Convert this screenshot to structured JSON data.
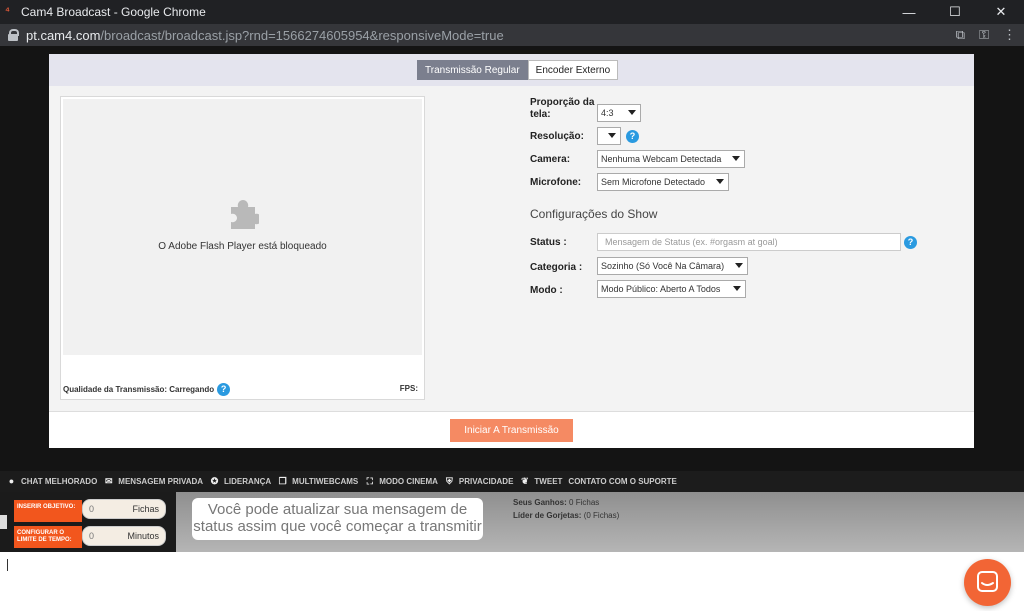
{
  "window": {
    "title": "Cam4 Broadcast - Google Chrome",
    "url_host": "pt.cam4.com",
    "url_path": "/broadcast/broadcast.jsp?rnd=1566274605954&responsiveMode=true"
  },
  "tabs": [
    {
      "label": "Transmissão Regular",
      "active": true
    },
    {
      "label": "Encoder Externo",
      "active": false
    }
  ],
  "video": {
    "blocked_message": "O Adobe Flash Player está bloqueado",
    "quality_label": "Qualidade da Transmissão: Carregando",
    "fps_label": "FPS:"
  },
  "settings": {
    "aspect_label": "Proporção da tela:",
    "aspect_value": "4:3",
    "resolution_label": "Resolução:",
    "resolution_value": "",
    "camera_label": "Camera:",
    "camera_value": "Nenhuma Webcam Detectada",
    "mic_label": "Microfone:",
    "mic_value": "Sem Microfone Detectado"
  },
  "show": {
    "title": "Configurações do Show",
    "status_label": "Status :",
    "status_placeholder": "Mensagem de Status (ex. #orgasm at goal)",
    "category_label": "Categoria :",
    "category_value": "Sozinho (Só Você Na Câmara)",
    "mode_label": "Modo :",
    "mode_value": "Modo Público: Aberto A Todos"
  },
  "start_button": "Iniciar A Transmissão",
  "toolbar": [
    {
      "icon": "chat-bubble-icon",
      "label": "CHAT MELHORADO"
    },
    {
      "icon": "envelope-icon",
      "label": "MENSAGEM PRIVADA"
    },
    {
      "icon": "medal-icon",
      "label": "LIDERANÇA"
    },
    {
      "icon": "multi-window-icon",
      "label": "MULTIWEBCAMS"
    },
    {
      "icon": "fullscreen-icon",
      "label": "MODO CINEMA"
    },
    {
      "icon": "shield-icon",
      "label": "PRIVACIDADE"
    },
    {
      "icon": "twitter-bird-icon",
      "label": "TWEET"
    },
    {
      "icon": "",
      "label": "CONTATO COM O SUPORTE"
    }
  ],
  "goal": {
    "objective_label": "INSERIR OBJETIVO:",
    "objective_value": "0",
    "objective_unit": "Fichas",
    "time_label": "CONFIGURAR O LIMITE DE TEMPO:",
    "time_value": "0",
    "time_unit": "Minutos"
  },
  "bubble_text": "Você pode atualizar sua mensagem de status assim que você começar a transmitir",
  "earnings": {
    "label": "Seus Ganhos:",
    "value": "0 Fichas",
    "leader_label": "Líder de Gorjetas:",
    "leader_value": "(0 Fichas)"
  },
  "colors": {
    "accent_orange": "#f58a63",
    "info_blue": "#2a9ae0",
    "goal_orange": "#f2561d"
  }
}
